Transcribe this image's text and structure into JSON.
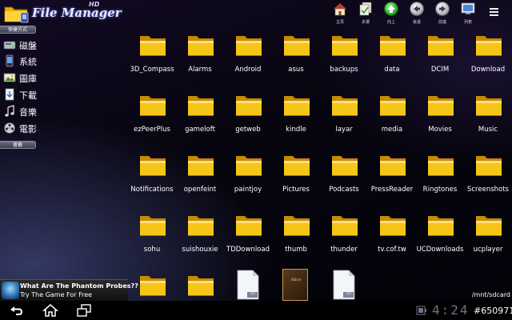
{
  "app": {
    "title": "File Manager",
    "title_sup": "HD"
  },
  "toolbar": {
    "buttons": [
      {
        "label": "主頁",
        "icon": "home-icon"
      },
      {
        "label": "多選",
        "icon": "multi-select-icon"
      },
      {
        "label": "向上",
        "icon": "up-arrow-icon"
      },
      {
        "label": "後退",
        "icon": "back-arrow-icon"
      },
      {
        "label": "前進",
        "icon": "forward-arrow-icon"
      },
      {
        "label": "列表",
        "icon": "list-view-icon"
      }
    ],
    "menu_icon": "overflow-menu-icon"
  },
  "sidebar": {
    "shortcuts_label": "快捷方式",
    "items": [
      {
        "label": "磁盤",
        "icon": "disk-icon"
      },
      {
        "label": "系統",
        "icon": "phone-icon"
      },
      {
        "label": "圖庫",
        "icon": "gallery-icon"
      },
      {
        "label": "下載",
        "icon": "download-icon"
      },
      {
        "label": "音樂",
        "icon": "music-icon"
      },
      {
        "label": "電影",
        "icon": "film-icon"
      }
    ],
    "bookmarks_label": "書籤"
  },
  "files": [
    {
      "name": "3D_Compass",
      "kind": "folder"
    },
    {
      "name": "Alarms",
      "kind": "folder"
    },
    {
      "name": "Android",
      "kind": "folder"
    },
    {
      "name": "asus",
      "kind": "folder"
    },
    {
      "name": "backups",
      "kind": "folder"
    },
    {
      "name": "data",
      "kind": "folder"
    },
    {
      "name": "DCIM",
      "kind": "folder"
    },
    {
      "name": "Download",
      "kind": "folder"
    },
    {
      "name": "ezPeerPlus",
      "kind": "folder"
    },
    {
      "name": "gameloft",
      "kind": "folder"
    },
    {
      "name": "getweb",
      "kind": "folder"
    },
    {
      "name": "kindle",
      "kind": "folder"
    },
    {
      "name": "layar",
      "kind": "folder"
    },
    {
      "name": "media",
      "kind": "folder"
    },
    {
      "name": "Movies",
      "kind": "folder"
    },
    {
      "name": "Music",
      "kind": "folder"
    },
    {
      "name": "Notifications",
      "kind": "folder"
    },
    {
      "name": "openfeint",
      "kind": "folder"
    },
    {
      "name": "paintjoy",
      "kind": "folder"
    },
    {
      "name": "Pictures",
      "kind": "folder"
    },
    {
      "name": "Podcasts",
      "kind": "folder"
    },
    {
      "name": "PressReader",
      "kind": "folder"
    },
    {
      "name": "Ringtones",
      "kind": "folder"
    },
    {
      "name": "Screenshots",
      "kind": "folder"
    },
    {
      "name": "sohu",
      "kind": "folder"
    },
    {
      "name": "suishouxie",
      "kind": "folder"
    },
    {
      "name": "TDDownload",
      "kind": "folder"
    },
    {
      "name": "thumb",
      "kind": "folder"
    },
    {
      "name": "thunder",
      "kind": "folder"
    },
    {
      "name": "tv.cof.tw",
      "kind": "folder"
    },
    {
      "name": "UCDownloads",
      "kind": "folder"
    },
    {
      "name": "ucplayer",
      "kind": "folder"
    },
    {
      "name": "",
      "kind": "folder"
    },
    {
      "name": "",
      "kind": "folder"
    },
    {
      "name": "",
      "kind": "document",
      "tag": "???"
    },
    {
      "name": "",
      "kind": "book",
      "cover_text": "Alice"
    },
    {
      "name": "",
      "kind": "document",
      "tag": "???"
    }
  ],
  "current_path": "/mnt/sdcard",
  "ad": {
    "title": "What Are The Phantom Probes??",
    "subtitle": "Try The Game For Free"
  },
  "system_bar": {
    "clock": "4:24",
    "id_text": "#650971",
    "buttons": [
      "back-nav-icon",
      "home-nav-icon",
      "recent-apps-icon"
    ]
  },
  "colors": {
    "folder": "#f5c518",
    "folder_dark": "#c98a00"
  }
}
